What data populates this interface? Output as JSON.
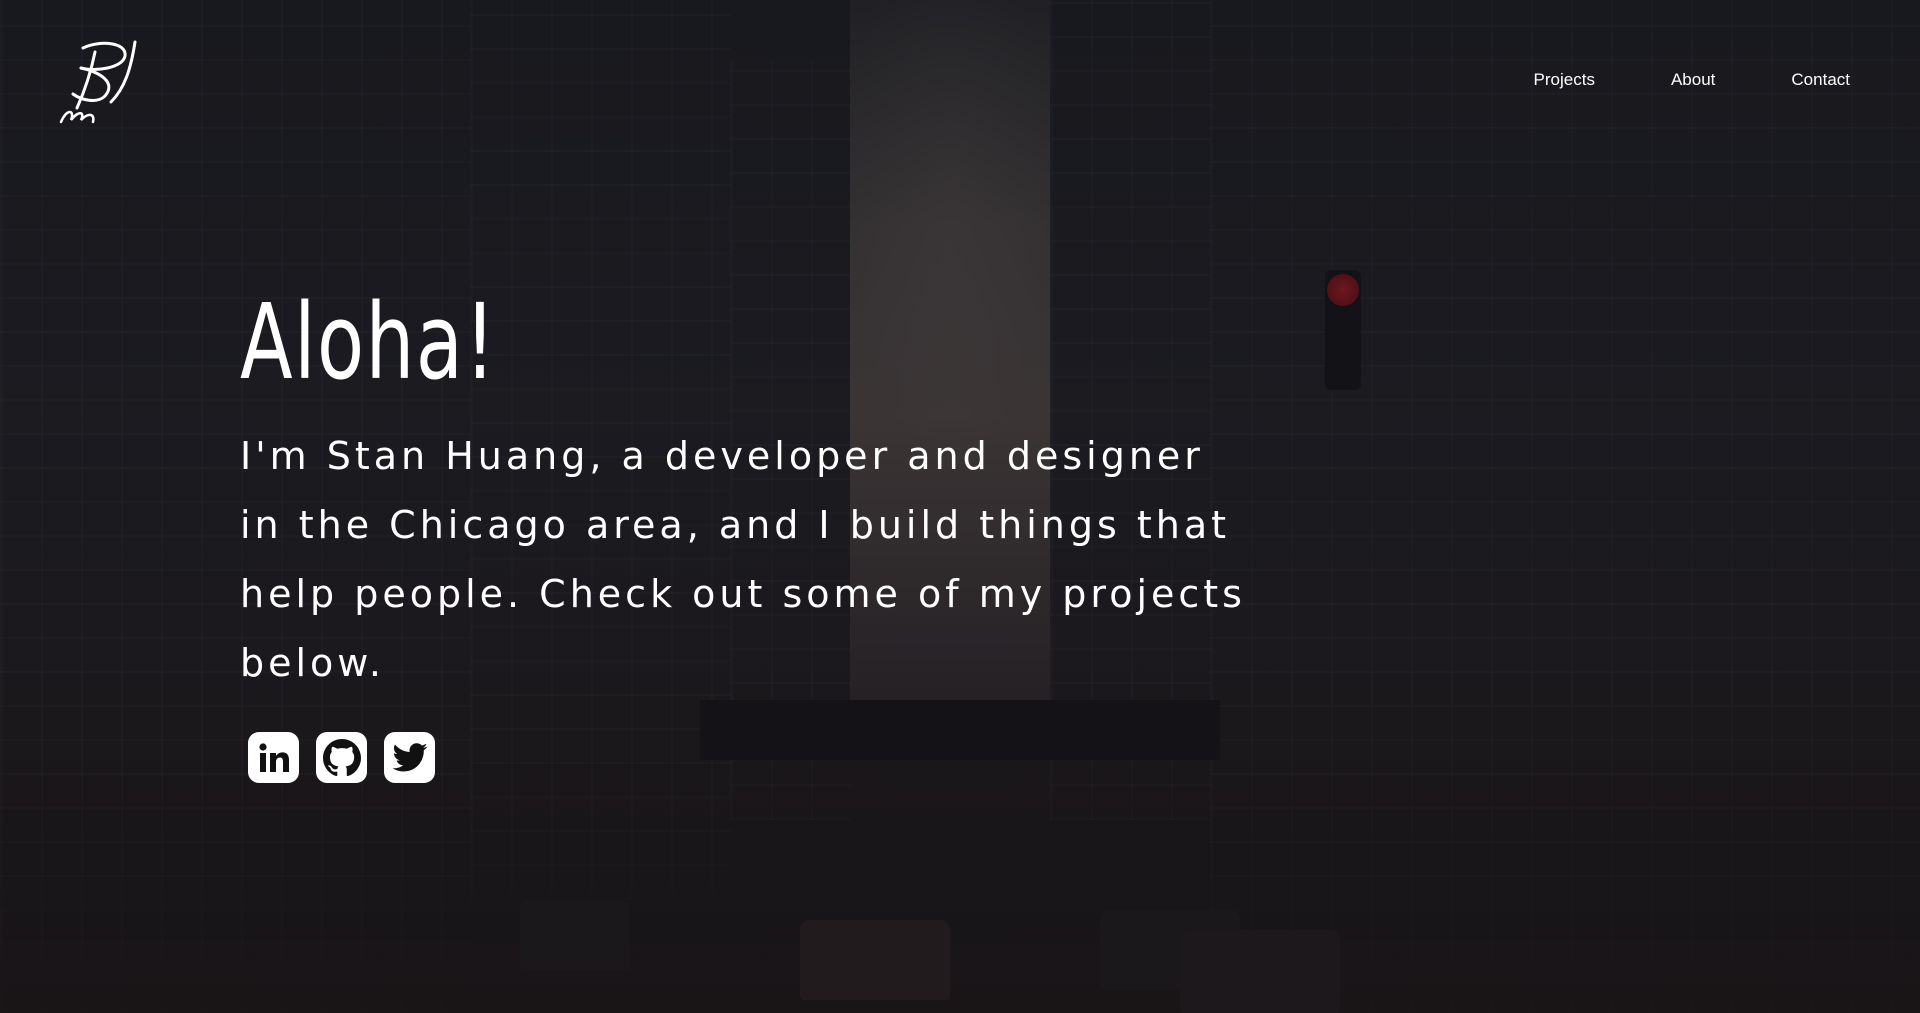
{
  "nav": {
    "items": [
      {
        "label": "Projects"
      },
      {
        "label": "About"
      },
      {
        "label": "Contact"
      }
    ]
  },
  "hero": {
    "greeting": "Aloha!",
    "intro": "I'm Stan Huang, a developer and designer in the Chicago area, and I build things that help people. Check out some of my projects below."
  },
  "socials": [
    {
      "icon": "linkedin-icon"
    },
    {
      "icon": "github-icon"
    },
    {
      "icon": "twitter-icon"
    }
  ],
  "colors": {
    "text": "#ffffff",
    "overlay": "#0f0f14",
    "traffic_light_red": "#e0242c"
  }
}
